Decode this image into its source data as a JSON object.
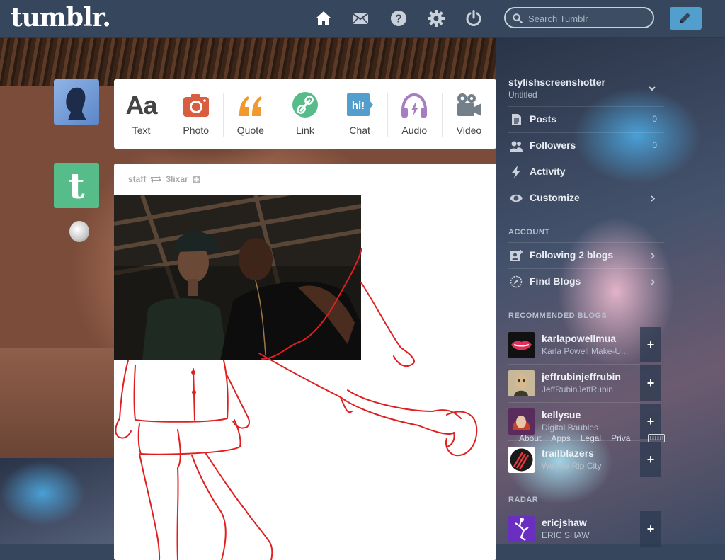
{
  "header": {
    "logo": "tumblr.",
    "search_placeholder": "Search Tumblr",
    "nav_icons": [
      "home-icon",
      "mail-icon",
      "help-icon",
      "gear-icon",
      "power-icon"
    ],
    "compose_icon": "pencil-icon"
  },
  "post_types": [
    {
      "label": "Text",
      "icon": "text-icon",
      "glyph": "Aa",
      "color": "#444444"
    },
    {
      "label": "Photo",
      "icon": "camera-icon",
      "color": "#d95e40"
    },
    {
      "label": "Quote",
      "icon": "quote-icon",
      "glyph": "❝",
      "color": "#f2992e"
    },
    {
      "label": "Link",
      "icon": "link-icon",
      "color": "#56bc8a"
    },
    {
      "label": "Chat",
      "icon": "chat-icon",
      "glyph": "hi!",
      "color": "#529ecc"
    },
    {
      "label": "Audio",
      "icon": "headphones-icon",
      "color": "#a77dc2"
    },
    {
      "label": "Video",
      "icon": "video-camera-icon",
      "color": "#748089"
    }
  ],
  "post": {
    "blog": "staff",
    "reblogged_from": "3lixar"
  },
  "sidebar": {
    "account_name": "stylishscreenshotter",
    "account_sub": "Untitled",
    "items": [
      {
        "label": "Posts",
        "count": "0",
        "icon": "document-icon"
      },
      {
        "label": "Followers",
        "count": "0",
        "icon": "people-icon"
      },
      {
        "label": "Activity",
        "count": "",
        "icon": "lightning-icon"
      },
      {
        "label": "Customize",
        "count": "",
        "icon": "eye-icon"
      }
    ],
    "account_heading": "ACCOUNT",
    "account_items": [
      {
        "label": "Following 2 blogs",
        "icon": "following-icon"
      },
      {
        "label": "Find Blogs",
        "icon": "compass-icon"
      }
    ],
    "recommended_heading": "RECOMMENDED BLOGS",
    "recommended": [
      {
        "name": "karlapowellmua",
        "sub": "Karla Powell Make-U..."
      },
      {
        "name": "jeffrubinjeffrubin",
        "sub": "JeffRubinJeffRubin"
      },
      {
        "name": "kellysue",
        "sub": "Digital Baubles"
      },
      {
        "name": "trailblazers",
        "sub": "We Are Rip City"
      }
    ],
    "footer_links": [
      "About",
      "Apps",
      "Legal",
      "Priva"
    ],
    "radar_heading": "RADAR",
    "radar": {
      "name": "ericjshaw",
      "sub": "ERIC SHAW"
    }
  },
  "colors": {
    "header_bg": "#36465d",
    "accent": "#529ecc",
    "dashboard_green": "#56bc8a"
  }
}
